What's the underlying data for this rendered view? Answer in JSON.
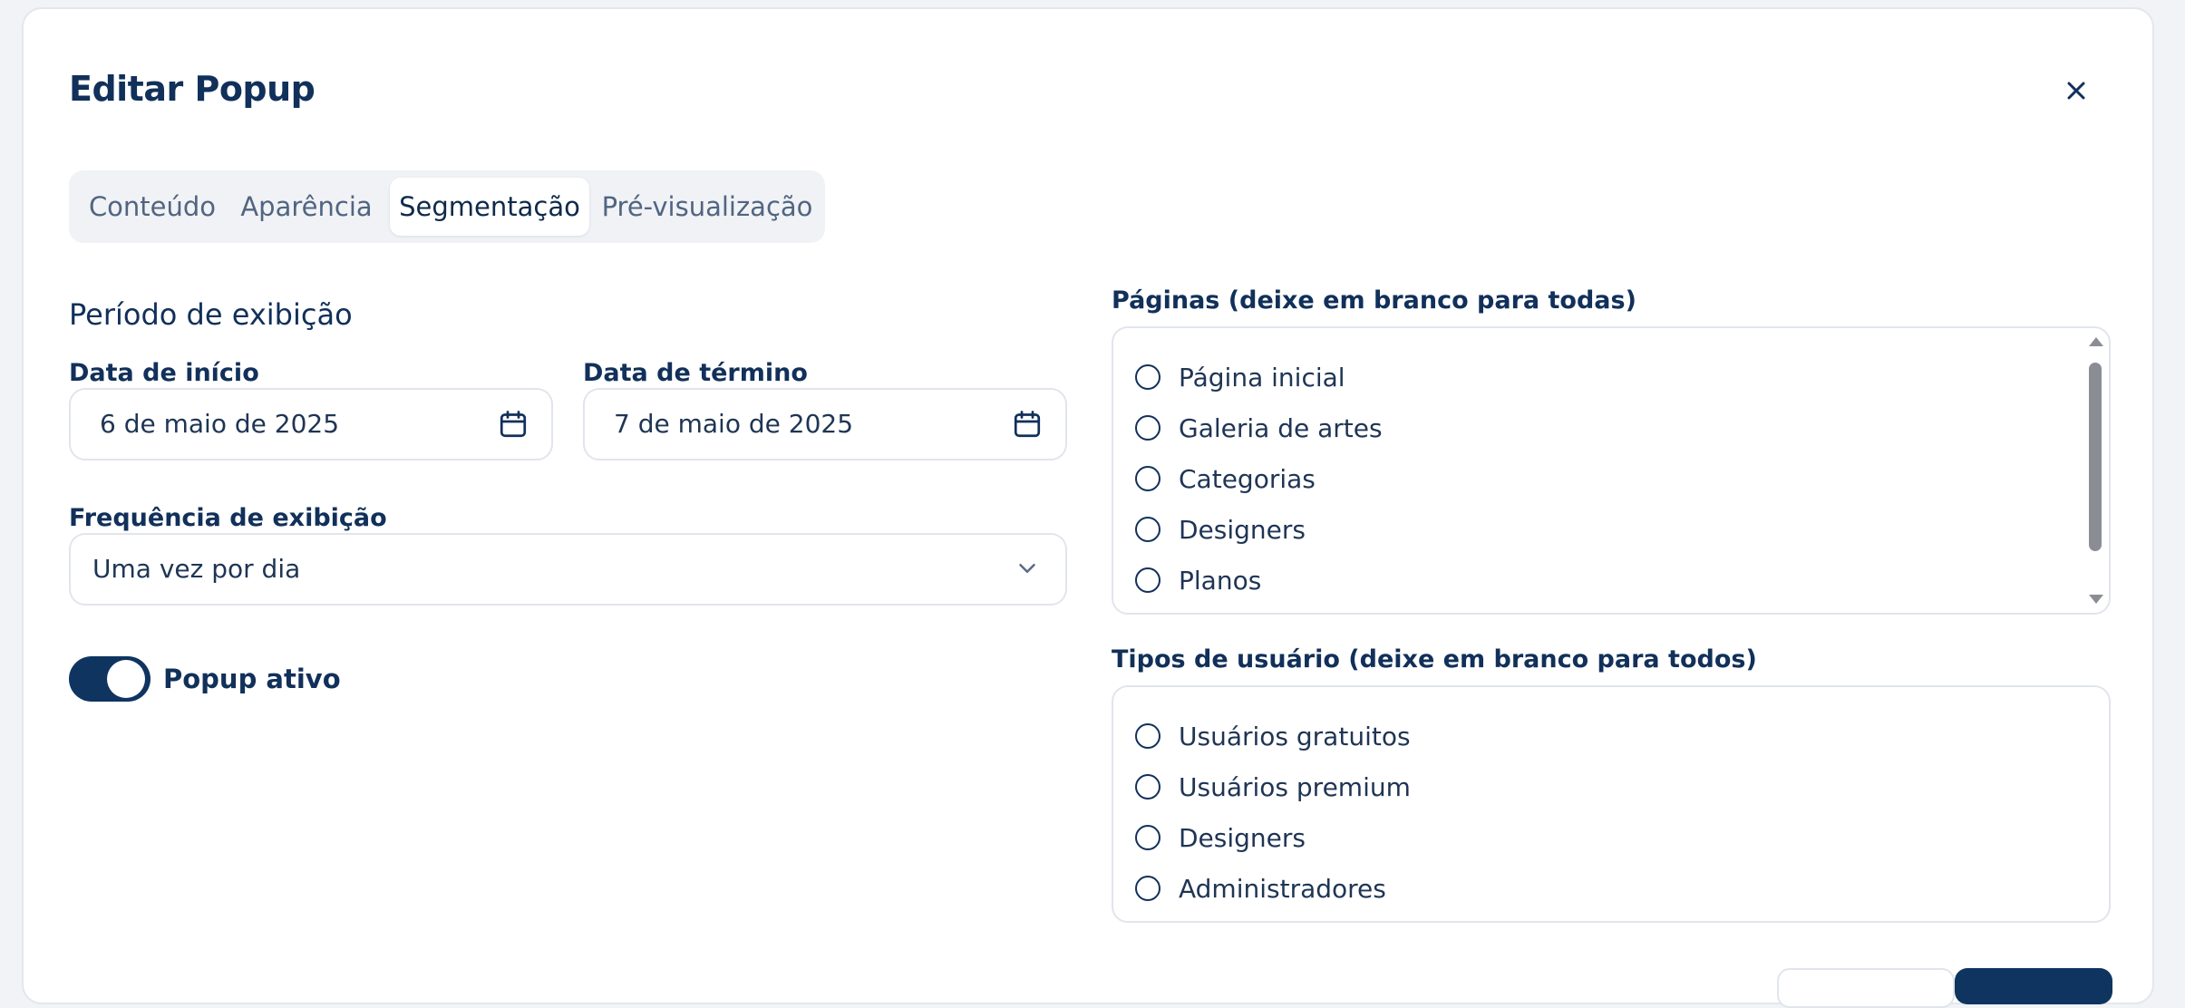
{
  "dialog": {
    "title": "Editar Popup",
    "close_icon": "close-icon"
  },
  "tabs": [
    {
      "label": "Conteúdo",
      "active": false
    },
    {
      "label": "Aparência",
      "active": false
    },
    {
      "label": "Segmentação",
      "active": true
    },
    {
      "label": "Pré-visualização",
      "active": false
    }
  ],
  "display_period": {
    "title": "Período de exibição",
    "start_label": "Data de início",
    "start_value": "6 de maio de 2025",
    "end_label": "Data de término",
    "end_value": "7 de maio de 2025",
    "date_icon": "calendar-icon"
  },
  "frequency": {
    "label": "Frequência de exibição",
    "value": "Uma vez por dia",
    "icon": "chevron-down-icon"
  },
  "active_toggle": {
    "label": "Popup ativo",
    "on": true
  },
  "pages": {
    "label": "Páginas (deixe em branco para todas)",
    "options": [
      "Página inicial",
      "Galeria de artes",
      "Categorias",
      "Designers",
      "Planos"
    ]
  },
  "user_types": {
    "label": "Tipos de usuário (deixe em branco para todos)",
    "options": [
      "Usuários gratuitos",
      "Usuários premium",
      "Designers",
      "Administradores"
    ]
  },
  "colors": {
    "primary": "#0f3460",
    "text": "#11305a",
    "muted": "#516581",
    "border": "#e1e5ec",
    "background": "#f1f3f6"
  }
}
